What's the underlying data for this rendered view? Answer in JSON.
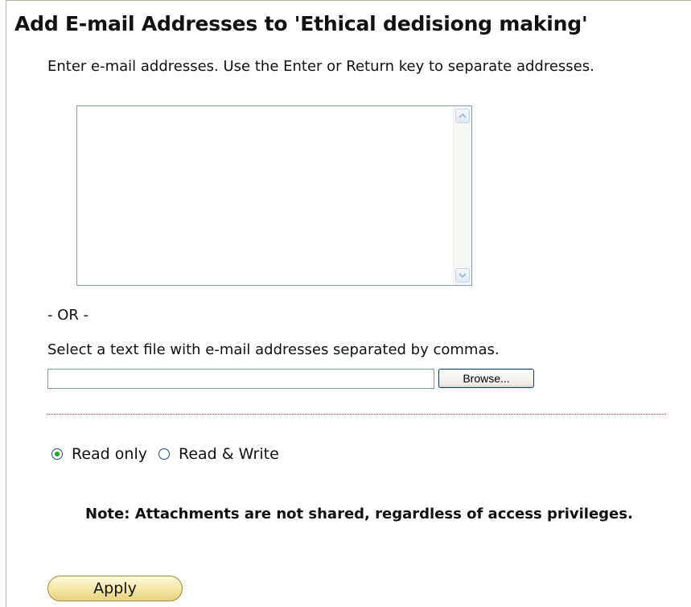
{
  "title": "Add E-mail Addresses to 'Ethical dedisiong making'",
  "instructions": "Enter e-mail addresses. Use the Enter or Return key to separate addresses.",
  "emails_textarea": {
    "value": ""
  },
  "or_separator": "- OR -",
  "file_select": {
    "label": "Select a text file with e-mail addresses separated by commas.",
    "value": "",
    "browse_label": "Browse..."
  },
  "access": {
    "read_only_label": "Read only",
    "read_write_label": "Read & Write",
    "selected": "read_only"
  },
  "note": "Note: Attachments are not shared, regardless of access privileges.",
  "apply_label": "Apply",
  "colors": {
    "panel_border": "#b9b38d",
    "divider": "#d04040",
    "radio_dot": "#21a121",
    "apply_bg": "#f3e5a3"
  }
}
